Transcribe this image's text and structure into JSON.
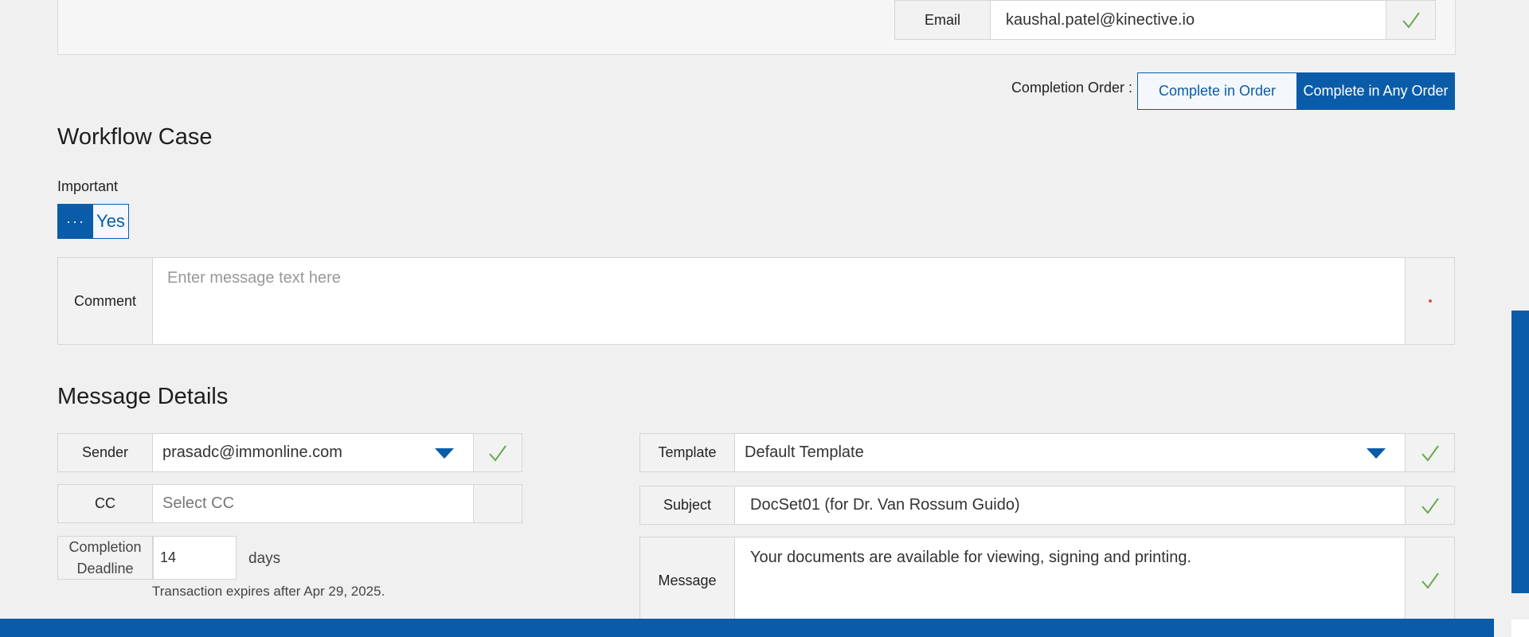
{
  "recipient": {
    "email_label": "Email",
    "email_value": "kaushal.patel@kinective.io"
  },
  "completion_order": {
    "label": "Completion Order :",
    "options": [
      "Complete in Order",
      "Complete in Any Order"
    ],
    "selected": "Complete in Any Order"
  },
  "workflow": {
    "title": "Workflow Case",
    "important_label": "Important",
    "toggle_off_label": "···",
    "toggle_on_label": "Yes",
    "comment_label": "Comment",
    "comment_placeholder": "Enter message text here"
  },
  "message_details": {
    "title": "Message Details",
    "sender_label": "Sender",
    "sender_value": "prasadc@immonline.com",
    "cc_label": "CC",
    "cc_placeholder": "Select CC",
    "deadline_label_line1": "Completion",
    "deadline_label_line2": "Deadline",
    "deadline_value": "14",
    "deadline_unit": "days",
    "expiry_note": "Transaction expires after Apr 29, 2025.",
    "template_label": "Template",
    "template_value": "Default Template",
    "subject_label": "Subject",
    "subject_value": "DocSet01 (for Dr. Van Rossum Guido)",
    "message_label": "Message",
    "message_value": "Your documents are available for viewing, signing and printing."
  },
  "colors": {
    "primary": "#0a5ca8",
    "check": "#6aa84f",
    "required_dot": "#d9534f"
  },
  "icons": {
    "check": "check-icon",
    "dropdown": "chevron-down-icon",
    "required": "required-dot-icon"
  }
}
